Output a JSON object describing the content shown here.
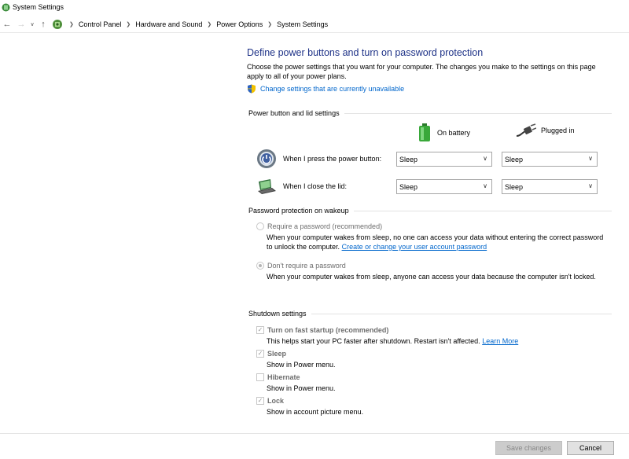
{
  "window": {
    "title": "System Settings"
  },
  "breadcrumb": {
    "items": [
      "Control Panel",
      "Hardware and Sound",
      "Power Options",
      "System Settings"
    ]
  },
  "main": {
    "title": "Define power buttons and turn on password protection",
    "intro": "Choose the power settings that you want for your computer. The changes you make to the settings on this page apply to all of your power plans.",
    "change_settings_link": "Change settings that are currently unavailable"
  },
  "power_section": {
    "heading": "Power button and lid settings",
    "col_battery": "On battery",
    "col_plugged": "Plugged in",
    "power_button": {
      "label": "When I press the power button:",
      "battery": "Sleep",
      "plugged": "Sleep"
    },
    "lid": {
      "label": "When I close the lid:",
      "battery": "Sleep",
      "plugged": "Sleep"
    }
  },
  "password_section": {
    "heading": "Password protection on wakeup",
    "require": {
      "label": "Require a password (recommended)",
      "desc": "When your computer wakes from sleep, no one can access your data without entering the correct password to unlock the computer.",
      "link": "Create or change your user account password"
    },
    "dont_require": {
      "label": "Don't require a password",
      "desc": "When your computer wakes from sleep, anyone can access your data because the computer isn't locked."
    }
  },
  "shutdown_section": {
    "heading": "Shutdown settings",
    "fast_startup": {
      "label": "Turn on fast startup (recommended)",
      "desc": "This helps start your PC faster after shutdown. Restart isn't affected.",
      "link": "Learn More",
      "checked": true
    },
    "sleep": {
      "label": "Sleep",
      "desc": "Show in Power menu.",
      "checked": true
    },
    "hibernate": {
      "label": "Hibernate",
      "desc": "Show in Power menu.",
      "checked": false
    },
    "lock": {
      "label": "Lock",
      "desc": "Show in account picture menu.",
      "checked": true
    }
  },
  "footer": {
    "save_label": "Save changes",
    "cancel_label": "Cancel"
  },
  "colors": {
    "heading_blue": "#1e3287",
    "link_blue": "#0066cc"
  }
}
